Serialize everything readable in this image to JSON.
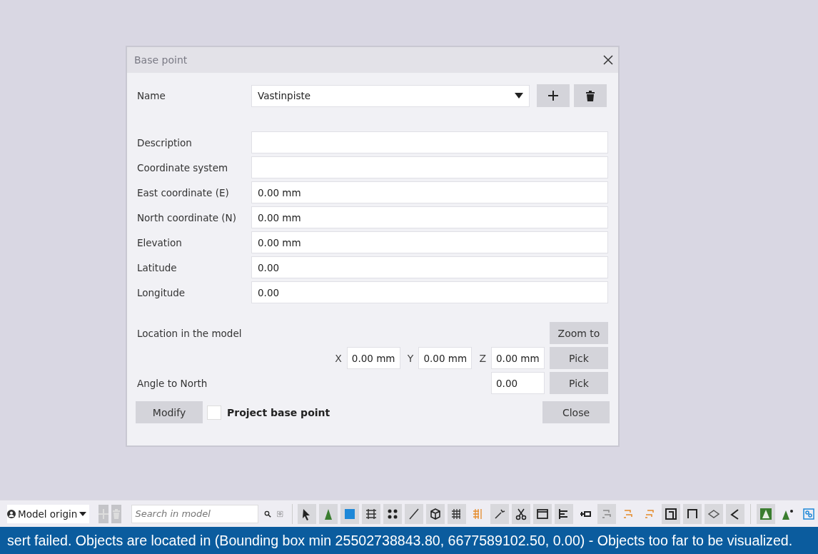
{
  "dialog": {
    "title": "Base point",
    "name_field": {
      "label": "Name",
      "value": "Vastinpiste"
    },
    "fields": [
      {
        "label": "Description"
      },
      {
        "label": "Coordinate system"
      },
      {
        "label": "East coordinate  (E)",
        "value": "0.00 mm"
      },
      {
        "label": "North coordinate  (N)",
        "value": "0.00 mm"
      },
      {
        "label": "Elevation",
        "value": "0.00 mm"
      },
      {
        "label": "Latitude",
        "value": "0.00"
      },
      {
        "label": "Longitude",
        "value": "0.00"
      }
    ],
    "location": {
      "label": "Location in the model",
      "zoom_button": "Zoom to",
      "pick_button": "Pick",
      "coords": [
        {
          "axis": "X",
          "value": "0.00 mm"
        },
        {
          "axis": "Y",
          "value": "0.00 mm"
        },
        {
          "axis": "Z",
          "value": "0.00 mm"
        }
      ]
    },
    "angle": {
      "label": "Angle to North",
      "value": "0.00",
      "pick_button": "Pick"
    },
    "modify_button": "Modify",
    "project_base_point": {
      "label": "Project base point",
      "checked": false
    },
    "close_button": "Close"
  },
  "toolbar": {
    "origin_dropdown": "Model origin",
    "search": {
      "placeholder": "Search in model"
    }
  },
  "status_bar": "sert failed. Objects are located in (Bounding box min 25502738843.80, 6677589102.50, 0.00) - Objects too far to be visualized."
}
